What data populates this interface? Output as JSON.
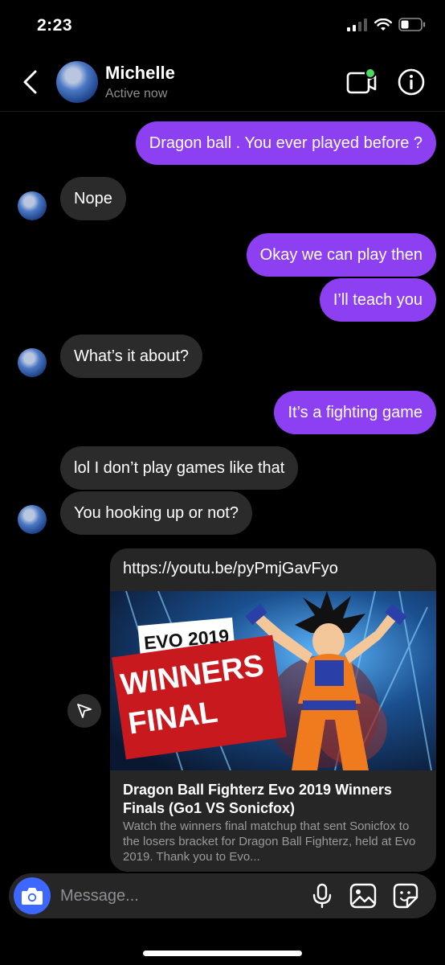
{
  "status_bar": {
    "time": "2:23"
  },
  "header": {
    "contact_name": "Michelle",
    "contact_status": "Active now"
  },
  "messages": [
    {
      "side": "out",
      "text": "Dragon ball . You ever played before ?"
    },
    {
      "side": "in",
      "text": "Nope"
    },
    {
      "side": "out",
      "text": "Okay we can play then"
    },
    {
      "side": "out",
      "text": "I’ll teach you"
    },
    {
      "side": "in",
      "text": "What’s it about?"
    },
    {
      "side": "out",
      "text": "It’s a fighting game"
    },
    {
      "side": "in",
      "text": "lol I don’t play games like that"
    },
    {
      "side": "in",
      "text": "You hooking up or not?"
    }
  ],
  "link_preview": {
    "url": "https://youtu.be/pyPmjGavFyo",
    "thumb_badge": "EVO 2019",
    "thumb_line1": "WINNERS",
    "thumb_line2": "FINAL",
    "title": "Dragon Ball Fighterz Evo 2019 Winners Finals (Go1 VS Sonicfox)",
    "description": "Watch the winners final matchup that sent Sonicfox to the losers bracket for Dragon Ball Fighterz, held at Evo 2019. Thank you to Evo..."
  },
  "composer": {
    "placeholder": "Message..."
  },
  "colors": {
    "outgoing": "#8d40f2",
    "incoming": "#2b2b2b",
    "camera": "#3c68ff",
    "active_dot": "#4cd964"
  }
}
